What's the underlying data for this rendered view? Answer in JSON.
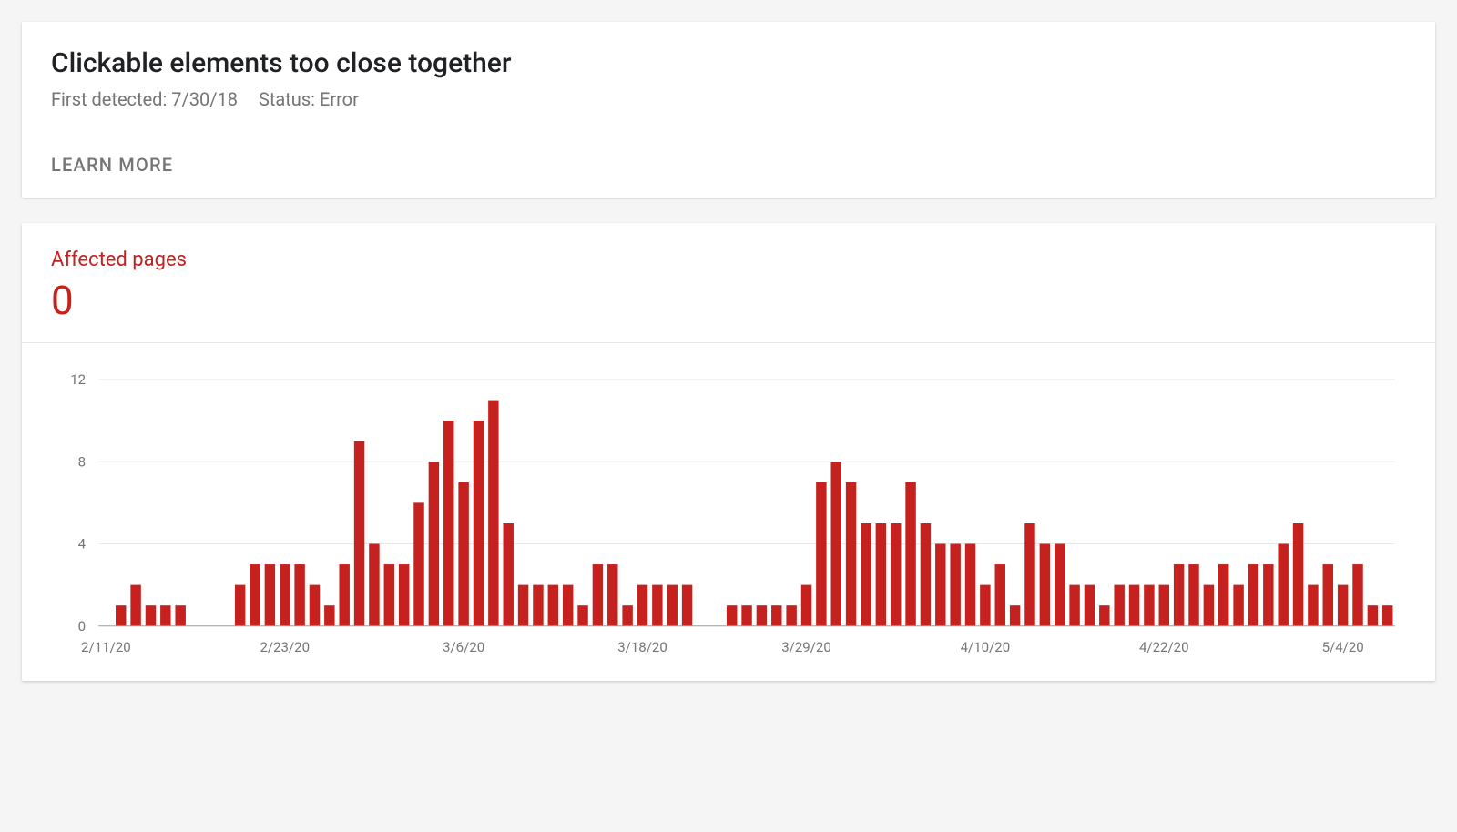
{
  "header": {
    "title": "Clickable elements too close together",
    "first_detected_label": "First detected:",
    "first_detected_value": "7/30/18",
    "status_label": "Status:",
    "status_value": "Error",
    "learn_more": "LEARN MORE"
  },
  "metric": {
    "label": "Affected pages",
    "value": "0"
  },
  "chart_data": {
    "type": "bar",
    "title": "",
    "xlabel": "",
    "ylabel": "",
    "ylim": [
      0,
      12
    ],
    "y_ticks": [
      0,
      4,
      8,
      12
    ],
    "x_tick_labels": [
      "2/11/20",
      "2/23/20",
      "3/6/20",
      "3/18/20",
      "3/29/20",
      "4/10/20",
      "4/22/20",
      "5/4/20"
    ],
    "x_tick_indices": [
      0,
      12,
      24,
      36,
      47,
      59,
      71,
      83
    ],
    "categories": [
      "2/11/20",
      "2/12/20",
      "2/13/20",
      "2/14/20",
      "2/15/20",
      "2/16/20",
      "2/17/20",
      "2/18/20",
      "2/19/20",
      "2/20/20",
      "2/21/20",
      "2/22/20",
      "2/23/20",
      "2/24/20",
      "2/25/20",
      "2/26/20",
      "2/27/20",
      "2/28/20",
      "2/29/20",
      "3/1/20",
      "3/2/20",
      "3/3/20",
      "3/4/20",
      "3/5/20",
      "3/6/20",
      "3/7/20",
      "3/8/20",
      "3/9/20",
      "3/10/20",
      "3/11/20",
      "3/12/20",
      "3/13/20",
      "3/14/20",
      "3/15/20",
      "3/16/20",
      "3/17/20",
      "3/18/20",
      "3/19/20",
      "3/20/20",
      "3/21/20",
      "3/22/20",
      "3/23/20",
      "3/24/20",
      "3/25/20",
      "3/26/20",
      "3/27/20",
      "3/28/20",
      "3/29/20",
      "3/30/20",
      "3/31/20",
      "4/1/20",
      "4/2/20",
      "4/3/20",
      "4/4/20",
      "4/5/20",
      "4/6/20",
      "4/7/20",
      "4/8/20",
      "4/9/20",
      "4/10/20",
      "4/11/20",
      "4/12/20",
      "4/13/20",
      "4/14/20",
      "4/15/20",
      "4/16/20",
      "4/17/20",
      "4/18/20",
      "4/19/20",
      "4/20/20",
      "4/21/20",
      "4/22/20",
      "4/23/20",
      "4/24/20",
      "4/25/20",
      "4/26/20",
      "4/27/20",
      "4/28/20",
      "4/29/20",
      "4/30/20",
      "5/1/20",
      "5/2/20",
      "5/3/20",
      "5/4/20",
      "5/5/20",
      "5/6/20"
    ],
    "values": [
      0,
      1,
      2,
      1,
      1,
      1,
      0,
      0,
      0,
      2,
      3,
      3,
      3,
      3,
      2,
      1,
      3,
      9,
      4,
      3,
      3,
      6,
      8,
      10,
      7,
      10,
      11,
      5,
      2,
      2,
      2,
      2,
      1,
      3,
      3,
      1,
      2,
      2,
      2,
      2,
      0,
      0,
      1,
      1,
      1,
      1,
      1,
      2,
      7,
      8,
      7,
      5,
      5,
      5,
      7,
      5,
      4,
      4,
      4,
      2,
      3,
      1,
      5,
      4,
      4,
      2,
      2,
      1,
      2,
      2,
      2,
      2,
      3,
      3,
      2,
      3,
      2,
      3,
      3,
      4,
      5,
      2,
      3,
      2,
      3,
      1,
      1
    ],
    "color": "#c5221f"
  }
}
